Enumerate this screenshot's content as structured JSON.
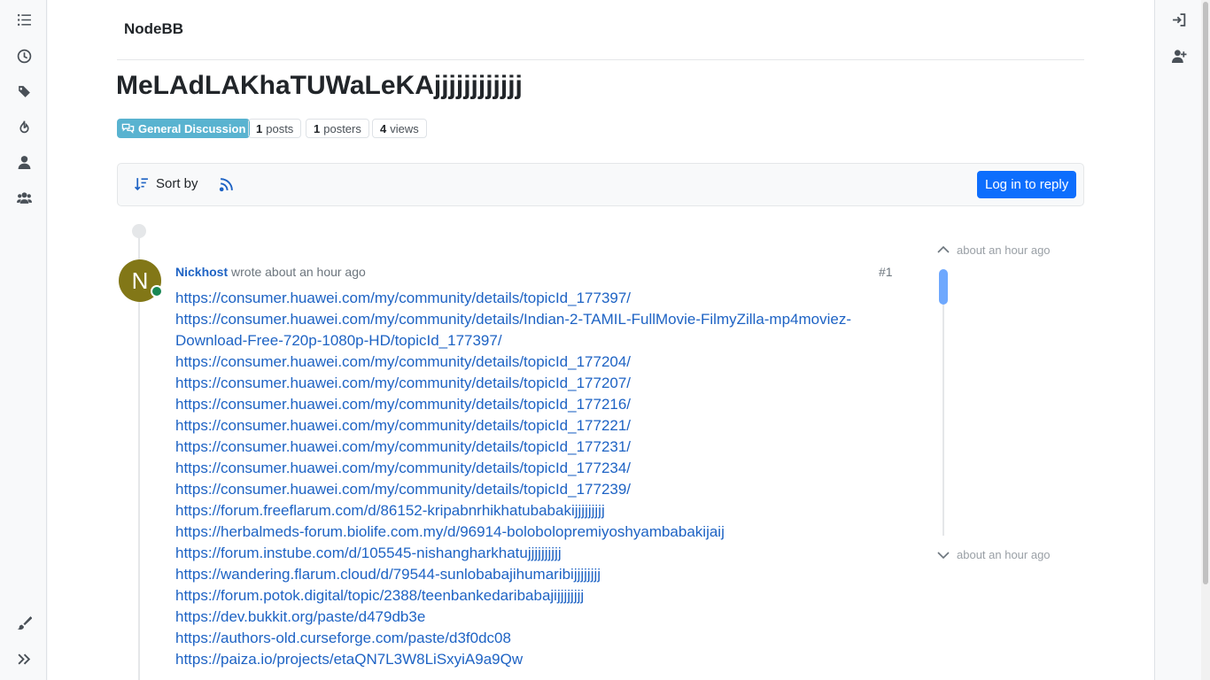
{
  "brand": {
    "name": "NodeBB"
  },
  "topic": {
    "title": "MeLAdLAKhaTUWaLeKAjjjjjjjjjjjj",
    "category": "General Discussion",
    "stats": {
      "posts_count": "1",
      "posts_label": "posts",
      "posters_count": "1",
      "posters_label": "posters",
      "views_count": "4",
      "views_label": "views"
    }
  },
  "toolbar": {
    "sort_label": "Sort by",
    "reply_label": "Log in to reply"
  },
  "post": {
    "avatar_letter": "N",
    "author": "Nickhost",
    "wrote": "wrote",
    "time": "about an hour ago",
    "index": "#1",
    "links": [
      "https://consumer.huawei.com/my/community/details/topicId_177397/",
      "https://consumer.huawei.com/my/community/details/Indian-2-TAMIL-FullMovie-FilmyZilla-mp4moviez-Download-Free-720p-1080p-HD/topicId_177397/",
      "https://consumer.huawei.com/my/community/details/topicId_177204/",
      "https://consumer.huawei.com/my/community/details/topicId_177207/",
      "https://consumer.huawei.com/my/community/details/topicId_177216/",
      "https://consumer.huawei.com/my/community/details/topicId_177221/",
      "https://consumer.huawei.com/my/community/details/topicId_177231/",
      "https://consumer.huawei.com/my/community/details/topicId_177234/",
      "https://consumer.huawei.com/my/community/details/topicId_177239/",
      "https://forum.freeflarum.com/d/86152-kripabnrhikhatubabakijjjjjjjjj",
      "https://herbalmeds-forum.biolife.com.my/d/96914-bolobolopremiyoshyambabakijaij",
      "https://forum.instube.com/d/105545-nishangharkhatujjjjjjjjjj",
      "https://wandering.flarum.cloud/d/79544-sunlobabajihumaribijjjjjjjj",
      "https://forum.potok.digital/topic/2388/teenbankedaribabajijjjjjjjj",
      "https://dev.bukkit.org/paste/d479db3e",
      "https://authors-old.curseforge.com/paste/d3f0dc08",
      "https://paiza.io/projects/etaQN7L3W8LiSxyiA9a9Qw"
    ]
  },
  "navigator": {
    "top_time": "about an hour ago",
    "bottom_time": "about an hour ago"
  },
  "colors": {
    "accent": "#0d6efd",
    "link": "#1e63c4",
    "category": "#59b3d0",
    "avatar": "#827717",
    "online": "#198754"
  },
  "icons": {
    "left_rail": [
      "list-icon",
      "clock-icon",
      "tags-icon",
      "fire-icon",
      "user-icon",
      "users-icon",
      "brush-icon",
      "expand-icon"
    ],
    "right_rail": [
      "login-icon",
      "register-icon"
    ]
  }
}
